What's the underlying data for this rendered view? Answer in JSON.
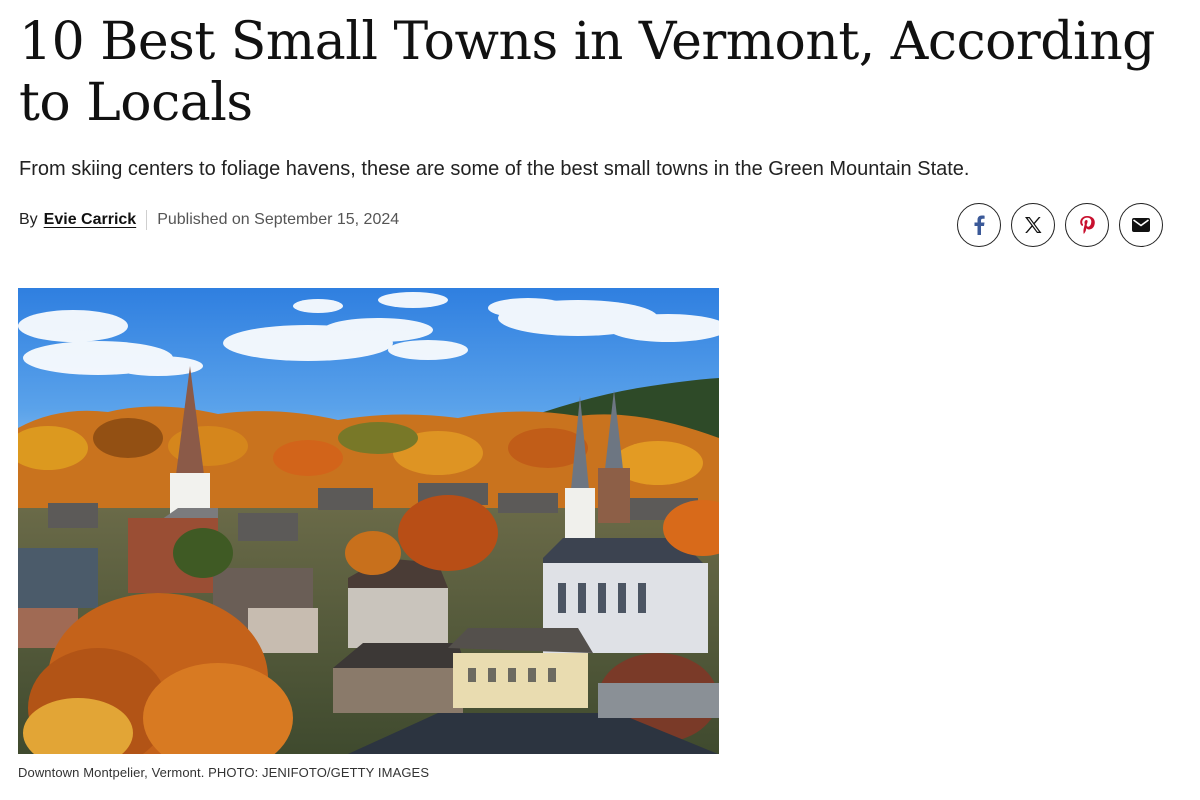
{
  "article": {
    "headline": "10 Best Small Towns in Vermont, According to Locals",
    "dek": "From skiing centers to foliage havens, these are some of the best small towns in the Green Mountain State.",
    "byline": {
      "prefix": "By",
      "author": "Evie Carrick",
      "published": "Published on September 15, 2024"
    },
    "image_caption": "Downtown Montpelier, Vermont. PHOTO: JENIFOTO/GETTY IMAGES"
  },
  "share_buttons": [
    {
      "icon": "facebook-icon"
    },
    {
      "icon": "x-icon"
    },
    {
      "icon": "pinterest-icon"
    },
    {
      "icon": "email-icon"
    }
  ],
  "colors": {
    "facebook": "#3b5998",
    "pinterest": "#c8102e",
    "text": "#1a1a1a",
    "sky": "#3a8be0"
  }
}
